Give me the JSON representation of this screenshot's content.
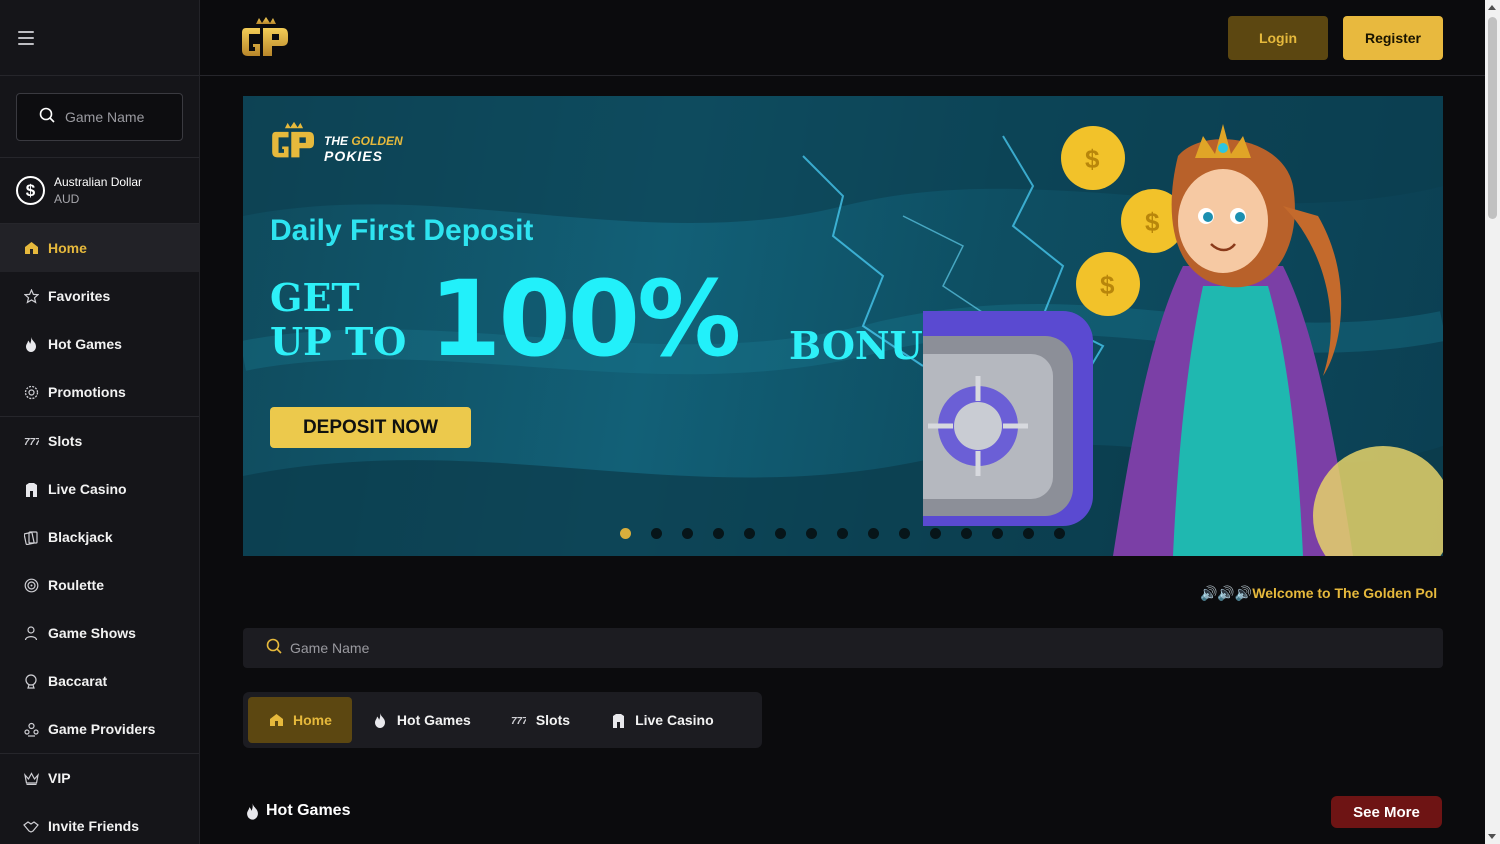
{
  "colors": {
    "accent": "#e6b93c",
    "accent_dark": "#5c4711",
    "bg": "#0b0b0d",
    "sidebar_bg": "#151519",
    "banner_cyan": "#22f0fa",
    "see_more_bg": "#6e1414"
  },
  "sidebar": {
    "search_placeholder": "Game Name",
    "currency": {
      "name": "Australian Dollar",
      "code": "AUD",
      "icon": "dollar-coin-icon"
    },
    "items": [
      {
        "label": "Home",
        "icon": "home-icon",
        "active": true
      },
      {
        "label": "Favorites",
        "icon": "star-icon"
      },
      {
        "label": "Hot Games",
        "icon": "flame-icon"
      },
      {
        "label": "Promotions",
        "icon": "gear-badge-icon"
      },
      {
        "label": "Slots",
        "icon": "slots-777-icon"
      },
      {
        "label": "Live Casino",
        "icon": "dealer-icon"
      },
      {
        "label": "Blackjack",
        "icon": "cards-icon"
      },
      {
        "label": "Roulette",
        "icon": "roulette-icon"
      },
      {
        "label": "Game Shows",
        "icon": "presenter-icon"
      },
      {
        "label": "Baccarat",
        "icon": "baccarat-icon"
      },
      {
        "label": "Game Providers",
        "icon": "providers-icon"
      },
      {
        "label": "VIP",
        "icon": "crown-icon"
      },
      {
        "label": "Invite Friends",
        "icon": "handshake-icon"
      }
    ]
  },
  "header": {
    "login_label": "Login",
    "register_label": "Register"
  },
  "banner": {
    "brand_the": "THE",
    "brand_golden": "GOLDEN",
    "brand_pokies": "POKIES",
    "subtitle": "Daily First Deposit",
    "get_line1": "GET",
    "get_line2": "UP TO",
    "percent": "100%",
    "bonus": "BONUS",
    "cta": "DEPOSIT NOW",
    "slides": 15,
    "active_slide": 0
  },
  "marquee": {
    "text": "🔊🔊🔊Welcome to The Golden Pol"
  },
  "main_search": {
    "placeholder": "Game Name"
  },
  "tabs": [
    {
      "label": "Home",
      "icon": "home-icon",
      "active": true
    },
    {
      "label": "Hot Games",
      "icon": "flame-icon"
    },
    {
      "label": "Slots",
      "icon": "slots-777-icon"
    },
    {
      "label": "Live Casino",
      "icon": "dealer-icon"
    }
  ],
  "hot_games": {
    "title": "Hot Games",
    "see_more": "See More"
  }
}
